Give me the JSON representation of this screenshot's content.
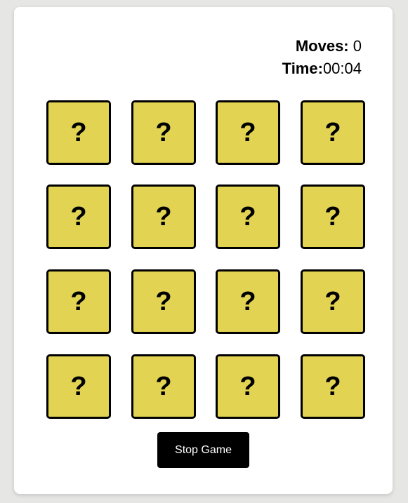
{
  "stats": {
    "moves_label": "Moves:",
    "moves_value": "0",
    "time_label": "Time:",
    "time_value": "00:04"
  },
  "cards": [
    "?",
    "?",
    "?",
    "?",
    "?",
    "?",
    "?",
    "?",
    "?",
    "?",
    "?",
    "?",
    "?",
    "?",
    "?",
    "?"
  ],
  "colors": {
    "card": "#e2d352",
    "button": "#000000"
  },
  "stop_button_label": "Stop Game"
}
